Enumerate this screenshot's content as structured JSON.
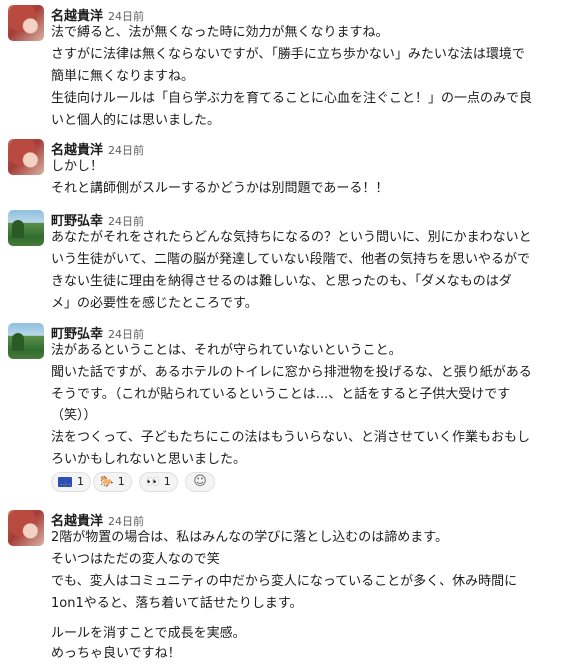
{
  "messages": [
    {
      "author": "名越貴洋",
      "time": "24日前",
      "avatar": "avatar-nagoshi",
      "lines": [
        "法で縛ると、法が無くなった時に効力が無くなりますね。",
        "さすがに法律は無くならないですが、「勝手に立ち歩かない」みたいな法は環境で",
        "簡単に無くなりますね。",
        "生徒向けルールは「自ら学ぶ力を育てることに心血を注ぐこと！」の一点のみで良",
        "いと個人的には思いました。"
      ]
    },
    {
      "author": "名越貴洋",
      "time": "24日前",
      "avatar": "avatar-nagoshi",
      "lines": [
        "しかし！",
        "それと講師側がスルーするかどうかは別問題であーる！！"
      ]
    },
    {
      "author": "町野弘幸",
      "time": "24日前",
      "avatar": "avatar-machino",
      "lines": [
        "あなたがそれをされたらどんな気持ちになるの？という問いに、別にかまわないと",
        "いう生徒がいて、二階の脳が発達していない段階で、他者の気持ちを思いやるがで",
        "きない生徒に理由を納得させるのは難しいな、と思ったのも、「ダメなものはダ",
        "メ」の必要性を感じたところです。"
      ]
    },
    {
      "author": "町野弘幸",
      "time": "24日前",
      "avatar": "avatar-machino",
      "lines": [
        "法があるということは、それが守られていないということ。",
        "聞いた話ですが、あるホテルのトイレに窓から排泄物を投げるな、と張り紙がある",
        "そうです。（これが貼られているということは...、と話をすると子供大受けです",
        "（笑））",
        "法をつくって、子どもたちにこの法はもういらない、と消させていく作業もおもし",
        "ろいかもしれないと思いました。"
      ],
      "reactions": [
        {
          "icon": "eu-flag-icon",
          "count": "1"
        },
        {
          "icon": "horse-icon",
          "emoji": "🐎",
          "count": "1"
        },
        {
          "icon": "eyes-icon",
          "emoji": "👀",
          "count": "1"
        }
      ]
    },
    {
      "author": "名越貴洋",
      "time": "24日前",
      "avatar": "avatar-nagoshi",
      "lines": [
        "2階が物置の場合は、私はみんなの学びに落とし込むのは諦めます。",
        "そいつはただの変人なので笑",
        "でも、変人はコミュニティの中だから変人になっていることが多く、休み時間に",
        "1on1やると、落ち着いて話せたりします。",
        "",
        "ルールを消すことで成長を実感。",
        "めっちゃ良いですね！"
      ]
    }
  ]
}
